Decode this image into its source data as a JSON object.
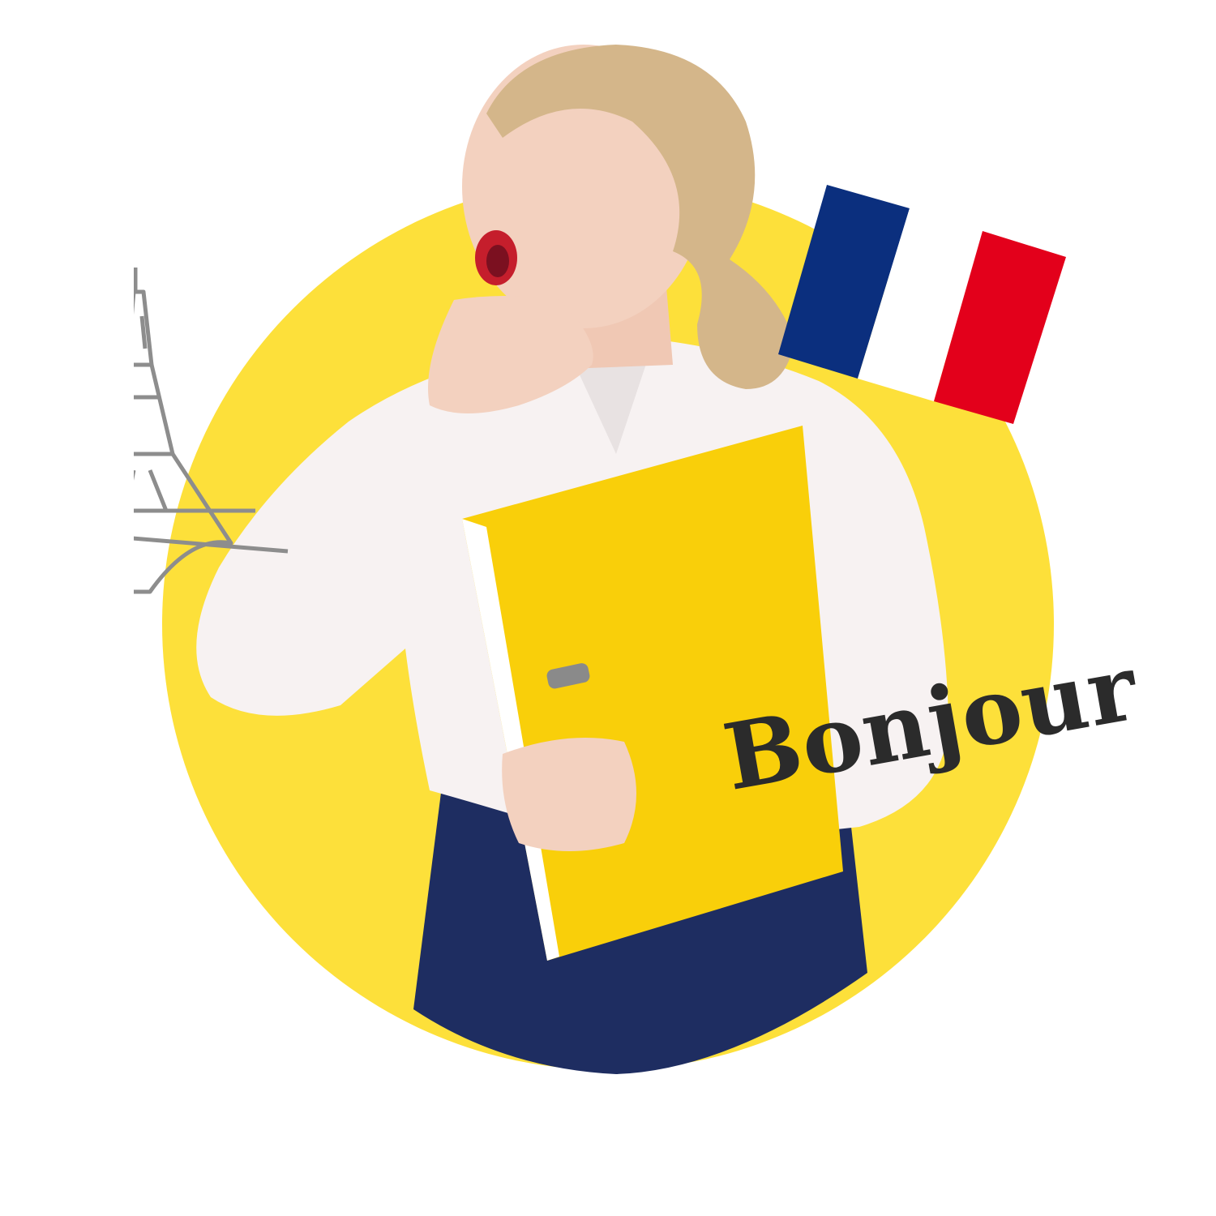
{
  "greeting": {
    "text": "Bonjour"
  },
  "icons": {
    "eiffel": "eiffel-tower-icon",
    "flag": "french-flag-icon"
  },
  "colors": {
    "circle": "#fde03a",
    "text": "#2b2b2b",
    "flag_blue": "#0b2f7e",
    "flag_white": "#ffffff",
    "flag_red": "#e3001b",
    "binder": "#f9cf0a",
    "shirt": "#f7f2f2",
    "skirt": "#1e2d61",
    "hair": "#d4b68a",
    "skin": "#f3d1bf",
    "eiffel": "#8d8d8d"
  }
}
